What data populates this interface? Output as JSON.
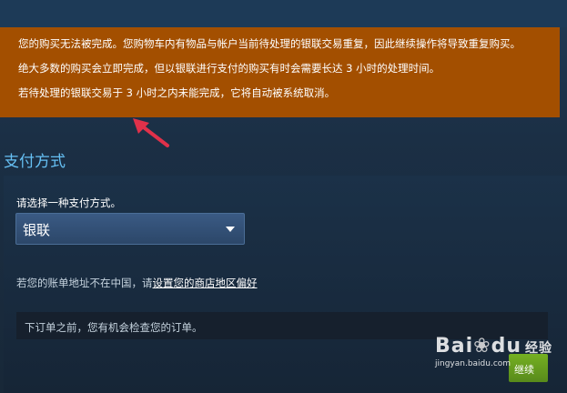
{
  "warning": {
    "line1": "您的购买无法被完成。您购物车内有物品与帐户当前待处理的银联交易重复，因此继续操作将导致重复购买。",
    "line2": "绝大多数的购买会立即完成，但以银联进行支付的购买有时会需要长达 3 小时的处理时间。",
    "line3": "若待处理的银联交易于 3 小时之内未能完成，它将自动被系统取消。"
  },
  "payment": {
    "section_title": "支付方式",
    "prompt": "请选择一种支付方式。",
    "selected_method": "银联",
    "region_text": "若您的账单地址不在中国，请",
    "region_link": "设置您的商店地区偏好",
    "review_text": "下订单之前，您有机会检查您的订单。",
    "continue_label": "继续"
  },
  "watermark": {
    "brand": "Bai",
    "brand2": "du",
    "jingyan": "经验",
    "url": "jingyan.baidu.com"
  },
  "colors": {
    "warning_bg": "#a34f00",
    "section_title": "#66c0f4",
    "button_green": "#75b022",
    "arrow_red": "#e0314a"
  }
}
